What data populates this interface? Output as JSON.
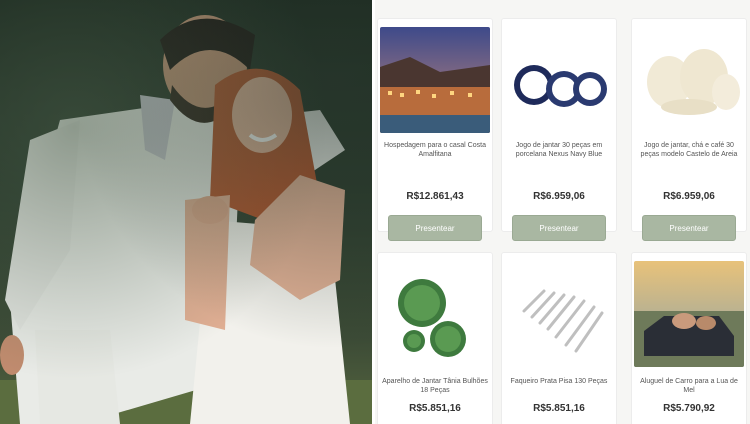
{
  "gifts": [
    {
      "name": "Hospedagem para o casal Costa Amalfitana",
      "price": "R$12.861,43",
      "button": "Presentear",
      "icon": "hotel-photo"
    },
    {
      "name": "Jogo de jantar 30 peças em porcelana Nexus Navy Blue",
      "price": "R$6.959,06",
      "button": "Presentear",
      "icon": "plates-navy"
    },
    {
      "name": "Jogo de jantar, chá e café 30 peças modelo Castelo de Areia",
      "price": "R$6.959,06",
      "button": "Presentear",
      "icon": "plates-cream"
    },
    {
      "name": "Aparelho de Jantar Tânia Bulhões 18 Peças",
      "price": "R$5.851,16",
      "icon": "plates-green"
    },
    {
      "name": "Faqueiro Prata Pisa 130 Peças",
      "price": "R$5.851,16",
      "icon": "cutlery"
    },
    {
      "name": "Aluguel de Carro para a Lua de Mel",
      "price": "R$5.790,92",
      "icon": "car-photo"
    }
  ],
  "colors": {
    "button_bg": "#a9b7a2",
    "button_text": "#ffffff",
    "price": "#333333"
  }
}
